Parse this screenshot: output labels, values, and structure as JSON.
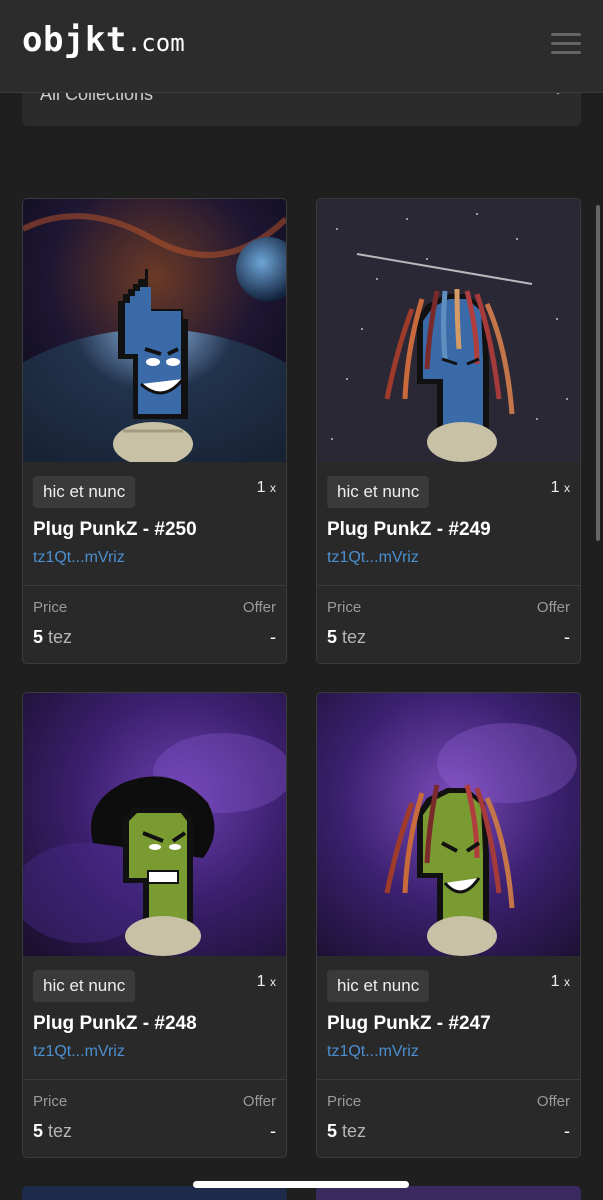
{
  "header": {
    "logo_main": "objkt",
    "logo_domain": ".com"
  },
  "filter": {
    "label": "All Collections"
  },
  "cards": [
    {
      "platform": "hic et nunc",
      "qty": "1",
      "qty_unit": "x",
      "title": "Plug PunkZ - #250",
      "creator": "tz1Qt...mVriz",
      "price_label": "Price",
      "offer_label": "Offer",
      "price": "5",
      "price_unit": "tez",
      "offer": "-"
    },
    {
      "platform": "hic et nunc",
      "qty": "1",
      "qty_unit": "x",
      "title": "Plug PunkZ - #249",
      "creator": "tz1Qt...mVriz",
      "price_label": "Price",
      "offer_label": "Offer",
      "price": "5",
      "price_unit": "tez",
      "offer": "-"
    },
    {
      "platform": "hic et nunc",
      "qty": "1",
      "qty_unit": "x",
      "title": "Plug PunkZ - #248",
      "creator": "tz1Qt...mVriz",
      "price_label": "Price",
      "offer_label": "Offer",
      "price": "5",
      "price_unit": "tez",
      "offer": "-"
    },
    {
      "platform": "hic et nunc",
      "qty": "1",
      "qty_unit": "x",
      "title": "Plug PunkZ - #247",
      "creator": "tz1Qt...mVriz",
      "price_label": "Price",
      "offer_label": "Offer",
      "price": "5",
      "price_unit": "tez",
      "offer": "-"
    }
  ],
  "colors": {
    "background": "#1f1f1f",
    "header": "#2c2c2c",
    "card": "#292929",
    "link": "#4c8fd0"
  },
  "icons": {
    "menu": "hamburger-menu-icon",
    "dropdown": "chevron-down-icon"
  }
}
